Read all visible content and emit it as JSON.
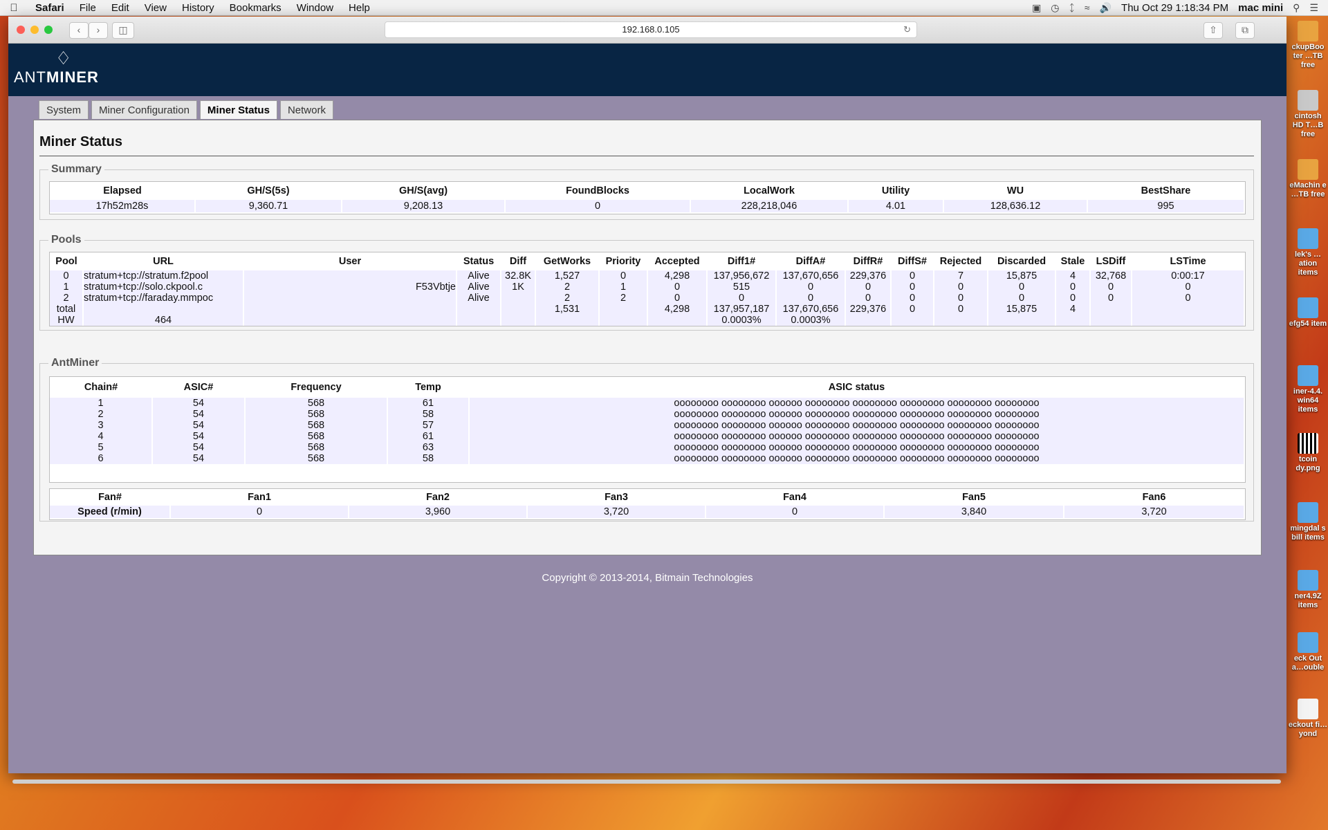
{
  "menubar": {
    "app": "Safari",
    "items": [
      "File",
      "Edit",
      "View",
      "History",
      "Bookmarks",
      "Window",
      "Help"
    ],
    "clock": "Thu Oct 29  1:18:34 PM",
    "user": "mac mini"
  },
  "desktop": [
    {
      "label": "ckupBoo ter …TB free"
    },
    {
      "label": "cintosh HD T…B free"
    },
    {
      "label": "eMachin e …TB free"
    },
    {
      "label": "lek's …ation items"
    },
    {
      "label": "efg54 item"
    },
    {
      "label": "iner-4.4. win64 items"
    },
    {
      "label": "tcoin dy.png"
    },
    {
      "label": "mingdal s bill items"
    },
    {
      "label": "ner4.9Z items"
    },
    {
      "label": "eck Out a…ouble"
    },
    {
      "label": "eckout fi…yond"
    }
  ],
  "browser": {
    "url": "192.168.0.105"
  },
  "header": {
    "brand_light": "ANT",
    "brand_bold": "MINER"
  },
  "tabs": [
    {
      "label": "System",
      "active": false
    },
    {
      "label": "Miner Configuration",
      "active": false
    },
    {
      "label": "Miner Status",
      "active": true
    },
    {
      "label": "Network",
      "active": false
    }
  ],
  "page_title": "Miner Status",
  "summary": {
    "legend": "Summary",
    "headers": [
      "Elapsed",
      "GH/S(5s)",
      "GH/S(avg)",
      "FoundBlocks",
      "LocalWork",
      "Utility",
      "WU",
      "BestShare"
    ],
    "values": [
      "17h52m28s",
      "9,360.71",
      "9,208.13",
      "0",
      "228,218,046",
      "4.01",
      "128,636.12",
      "995"
    ]
  },
  "pools": {
    "legend": "Pools",
    "headers": [
      "Pool",
      "URL",
      "User",
      "Status",
      "Diff",
      "GetWorks",
      "Priority",
      "Accepted",
      "Diff1#",
      "DiffA#",
      "DiffR#",
      "DiffS#",
      "Rejected",
      "Discarded",
      "Stale",
      "LSDiff",
      "LSTime"
    ],
    "rows": [
      [
        "0",
        "stratum+tcp://stratum.f2pool",
        "",
        "Alive",
        "32.8K",
        "1,527",
        "0",
        "4,298",
        "137,956,672",
        "137,670,656",
        "229,376",
        "0",
        "7",
        "15,875",
        "4",
        "32,768",
        "0:00:17"
      ],
      [
        "1",
        "stratum+tcp://solo.ckpool.c",
        "F53Vbtje",
        "Alive",
        "1K",
        "2",
        "1",
        "0",
        "515",
        "0",
        "0",
        "0",
        "0",
        "0",
        "0",
        "0",
        "0"
      ],
      [
        "2",
        "stratum+tcp://faraday.mmpoc",
        "",
        "Alive",
        "",
        "2",
        "2",
        "0",
        "0",
        "0",
        "0",
        "0",
        "0",
        "0",
        "0",
        "0",
        "0"
      ],
      [
        "total",
        "",
        "",
        "",
        "",
        "1,531",
        "",
        "4,298",
        "137,957,187",
        "137,670,656",
        "229,376",
        "0",
        "0",
        "15,875",
        "4",
        "",
        ""
      ]
    ],
    "hw_label": "HW",
    "hw_value": "464",
    "hw_diff1": "0.0003%",
    "hw_diffa": "0.0003%"
  },
  "antminer": {
    "legend": "AntMiner",
    "headers": [
      "Chain#",
      "ASIC#",
      "Frequency",
      "Temp",
      "ASIC status"
    ],
    "rows": [
      [
        "1",
        "54",
        "568",
        "61",
        "oooooooo oooooooo oooooo oooooooo oooooooo oooooooo oooooooo oooooooo"
      ],
      [
        "2",
        "54",
        "568",
        "58",
        "oooooooo oooooooo oooooo oooooooo oooooooo oooooooo oooooooo oooooooo"
      ],
      [
        "3",
        "54",
        "568",
        "57",
        "oooooooo oooooooo oooooo oooooooo oooooooo oooooooo oooooooo oooooooo"
      ],
      [
        "4",
        "54",
        "568",
        "61",
        "oooooooo oooooooo oooooo oooooooo oooooooo oooooooo oooooooo oooooooo"
      ],
      [
        "5",
        "54",
        "568",
        "63",
        "oooooooo oooooooo oooooo oooooooo oooooooo oooooooo oooooooo oooooooo"
      ],
      [
        "6",
        "54",
        "568",
        "58",
        "oooooooo oooooooo oooooo oooooooo oooooooo oooooooo oooooooo oooooooo"
      ]
    ],
    "fan_headers": [
      "Fan#",
      "Fan1",
      "Fan2",
      "Fan3",
      "Fan4",
      "Fan5",
      "Fan6"
    ],
    "fan_values": [
      "Speed (r/min)",
      "0",
      "3,960",
      "3,720",
      "0",
      "3,840",
      "3,720"
    ]
  },
  "footer": "Copyright © 2013-2014, Bitmain Technologies"
}
